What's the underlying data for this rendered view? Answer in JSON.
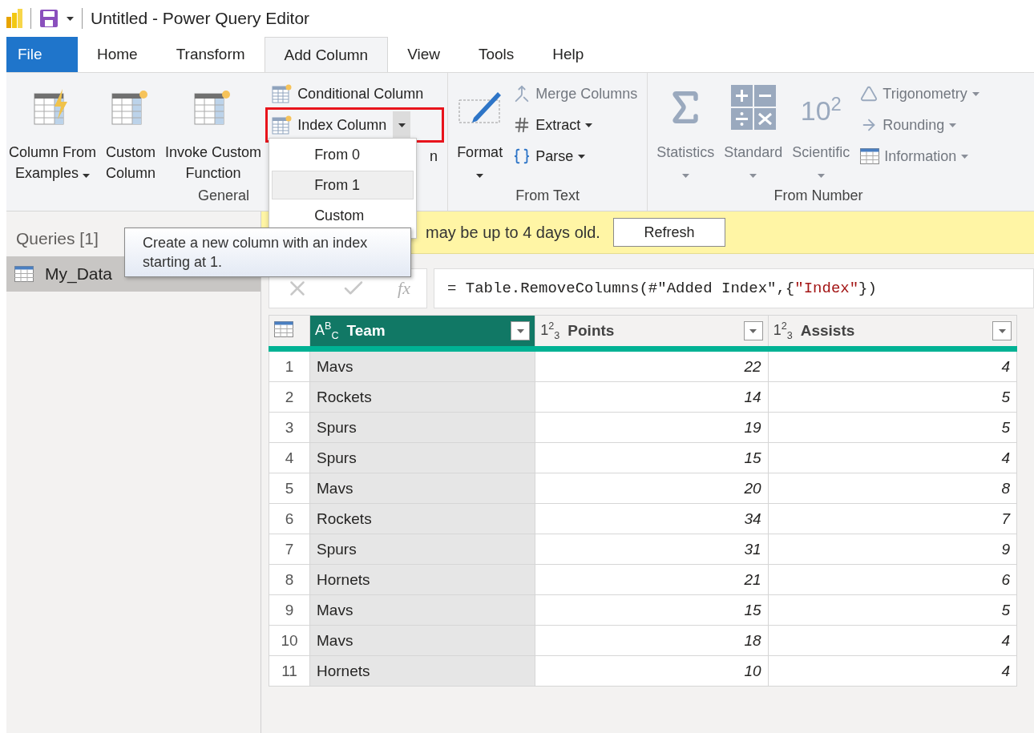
{
  "window": {
    "title": "Untitled - Power Query Editor"
  },
  "tabs": [
    {
      "label": "File",
      "kind": "file",
      "selected": false
    },
    {
      "label": "Home",
      "kind": "tab",
      "selected": false
    },
    {
      "label": "Transform",
      "kind": "tab",
      "selected": false
    },
    {
      "label": "Add Column",
      "kind": "tab",
      "selected": true
    },
    {
      "label": "View",
      "kind": "tab",
      "selected": false
    },
    {
      "label": "Tools",
      "kind": "tab",
      "selected": false
    },
    {
      "label": "Help",
      "kind": "tab",
      "selected": false
    }
  ],
  "ribbon": {
    "groups": [
      {
        "label": "General",
        "items": [
          {
            "kind": "large",
            "lines": [
              "Column From",
              "Examples"
            ],
            "dropdown": true,
            "disabled": false
          },
          {
            "kind": "large",
            "lines": [
              "Custom",
              "Column"
            ],
            "dropdown": false,
            "disabled": false
          },
          {
            "kind": "large",
            "lines": [
              "Invoke Custom",
              "Function"
            ],
            "dropdown": false,
            "disabled": false
          },
          {
            "kind": "stack",
            "items": [
              {
                "label": "Conditional Column",
                "dropdown": false,
                "disabled": false
              },
              {
                "label": "Index Column",
                "dropdown": true,
                "disabled": false,
                "outlined": true,
                "expanded": true,
                "menu": [
                  {
                    "label": "From 0",
                    "selected": false
                  },
                  {
                    "label": "From 1",
                    "selected": true
                  },
                  {
                    "label": "Custom",
                    "selected": false
                  }
                ]
              },
              {
                "label": "n",
                "dropdown": false,
                "disabled": false
              }
            ]
          }
        ]
      },
      {
        "label": "From Text",
        "items": [
          {
            "kind": "large",
            "lines": [
              "Format"
            ],
            "dropdown": true,
            "disabled": false
          },
          {
            "kind": "stack",
            "items": [
              {
                "label": "Merge Columns",
                "dropdown": false,
                "disabled": true
              },
              {
                "label": "Extract",
                "dropdown": true,
                "disabled": false
              },
              {
                "label": "Parse",
                "dropdown": true,
                "disabled": false
              }
            ]
          }
        ]
      },
      {
        "label": "From Number",
        "items": [
          {
            "kind": "large",
            "lines": [
              "Statistics"
            ],
            "dropdown": true,
            "disabled": true
          },
          {
            "kind": "large",
            "lines": [
              "Standard"
            ],
            "dropdown": true,
            "disabled": true
          },
          {
            "kind": "large",
            "lines": [
              "Scientific"
            ],
            "dropdown": true,
            "disabled": true,
            "icon_text": "10$^{2}$"
          },
          {
            "kind": "stack",
            "items": [
              {
                "label": "Trigonometry",
                "dropdown": true,
                "disabled": true
              },
              {
                "label": "Rounding",
                "dropdown": true,
                "disabled": true
              },
              {
                "label": "Information",
                "dropdown": true,
                "disabled": true
              }
            ]
          }
        ]
      }
    ]
  },
  "tooltip": {
    "text": "Create a new column with an index starting at 1."
  },
  "queries": {
    "title": "Queries [1]",
    "items": [
      {
        "label": "My_Data",
        "selected": true
      }
    ]
  },
  "info_bar": {
    "message": "may be up to 4 days old.",
    "button": "Refresh"
  },
  "formula_bar": {
    "function_symbol": "fx",
    "segments": [
      {
        "text": "= Table.RemoveColumns(#\"Added Index\",{",
        "kind": "code"
      },
      {
        "text": "\"Index\"",
        "kind": "string"
      },
      {
        "text": "})",
        "kind": "code"
      }
    ]
  },
  "table": {
    "columns": [
      {
        "type_label": "A$^{B}$$_{C}$",
        "name": "Team",
        "kind": "text",
        "selected": true
      },
      {
        "type_label": "1$^{2}$$_{3}$",
        "name": "Points",
        "kind": "number",
        "selected": false
      },
      {
        "type_label": "1$^{2}$$_{3}$",
        "name": "Assists",
        "kind": "number",
        "selected": false
      }
    ],
    "rows": [
      {
        "number": "1",
        "cells": [
          "Mavs",
          "22",
          "4"
        ]
      },
      {
        "number": "2",
        "cells": [
          "Rockets",
          "14",
          "5"
        ]
      },
      {
        "number": "3",
        "cells": [
          "Spurs",
          "19",
          "5"
        ]
      },
      {
        "number": "4",
        "cells": [
          "Spurs",
          "15",
          "4"
        ]
      },
      {
        "number": "5",
        "cells": [
          "Mavs",
          "20",
          "8"
        ]
      },
      {
        "number": "6",
        "cells": [
          "Rockets",
          "34",
          "7"
        ]
      },
      {
        "number": "7",
        "cells": [
          "Spurs",
          "31",
          "9"
        ]
      },
      {
        "number": "8",
        "cells": [
          "Hornets",
          "21",
          "6"
        ]
      },
      {
        "number": "9",
        "cells": [
          "Mavs",
          "15",
          "5"
        ]
      },
      {
        "number": "10",
        "cells": [
          "Mavs",
          "18",
          "4"
        ]
      },
      {
        "number": "11",
        "cells": [
          "Hornets",
          "10",
          "4"
        ]
      }
    ]
  }
}
